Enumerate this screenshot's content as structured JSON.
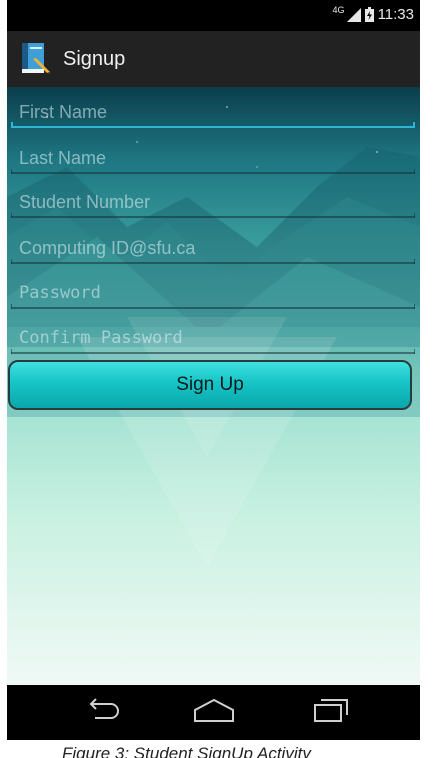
{
  "status_bar": {
    "network_type": "4G",
    "time": "11:33",
    "icons": [
      "signal-icon",
      "battery-icon"
    ]
  },
  "action_bar": {
    "title": "Signup",
    "icon": "app-icon"
  },
  "form": {
    "first_name": {
      "placeholder": "First Name",
      "value": "",
      "focused": true
    },
    "last_name": {
      "placeholder": "Last Name",
      "value": ""
    },
    "student_number": {
      "placeholder": "Student Number",
      "value": ""
    },
    "computing_id": {
      "placeholder": "Computing ID@sfu.ca",
      "value": ""
    },
    "password": {
      "placeholder": "Password",
      "value": ""
    },
    "confirm_password": {
      "placeholder": "Confirm Password",
      "value": ""
    },
    "signup_button": "Sign Up"
  },
  "nav_bar": {
    "icons": [
      "back-icon",
      "home-icon",
      "recents-icon"
    ]
  },
  "caption": "Figure 3: Student SignUp Activity",
  "colors": {
    "accent": "#2fb6d6",
    "button": "#16c4c6",
    "action_bar": "#222222"
  }
}
